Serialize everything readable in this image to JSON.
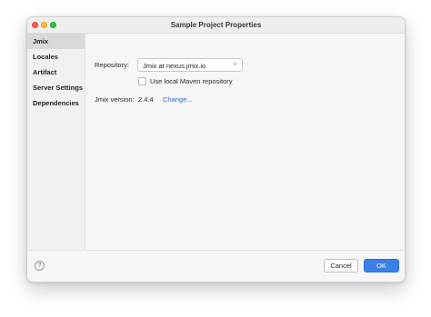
{
  "window": {
    "title": "Sample Project Properties"
  },
  "sidebar": {
    "items": [
      {
        "label": "Jmix",
        "active": true
      },
      {
        "label": "Locales",
        "active": false
      },
      {
        "label": "Artifact",
        "active": false
      },
      {
        "label": "Server Settings",
        "active": false
      },
      {
        "label": "Dependencies",
        "active": false
      }
    ]
  },
  "main": {
    "repository_label": "Repository:",
    "repository_value": "Jmix at nexus.jmix.io",
    "use_local_maven_label": "Use local Maven repository",
    "use_local_maven_checked": false,
    "jmix_version_label": "Jmix version:",
    "jmix_version_value": "2.4.4",
    "change_link": "Change..."
  },
  "footer": {
    "help": "?",
    "cancel_label": "Cancel",
    "ok_label": "OK"
  },
  "colors": {
    "accent": "#3c7fe8",
    "link": "#2d6cc9",
    "close": "#fe5f57",
    "minimize": "#febc2e",
    "maximize": "#28c840"
  }
}
